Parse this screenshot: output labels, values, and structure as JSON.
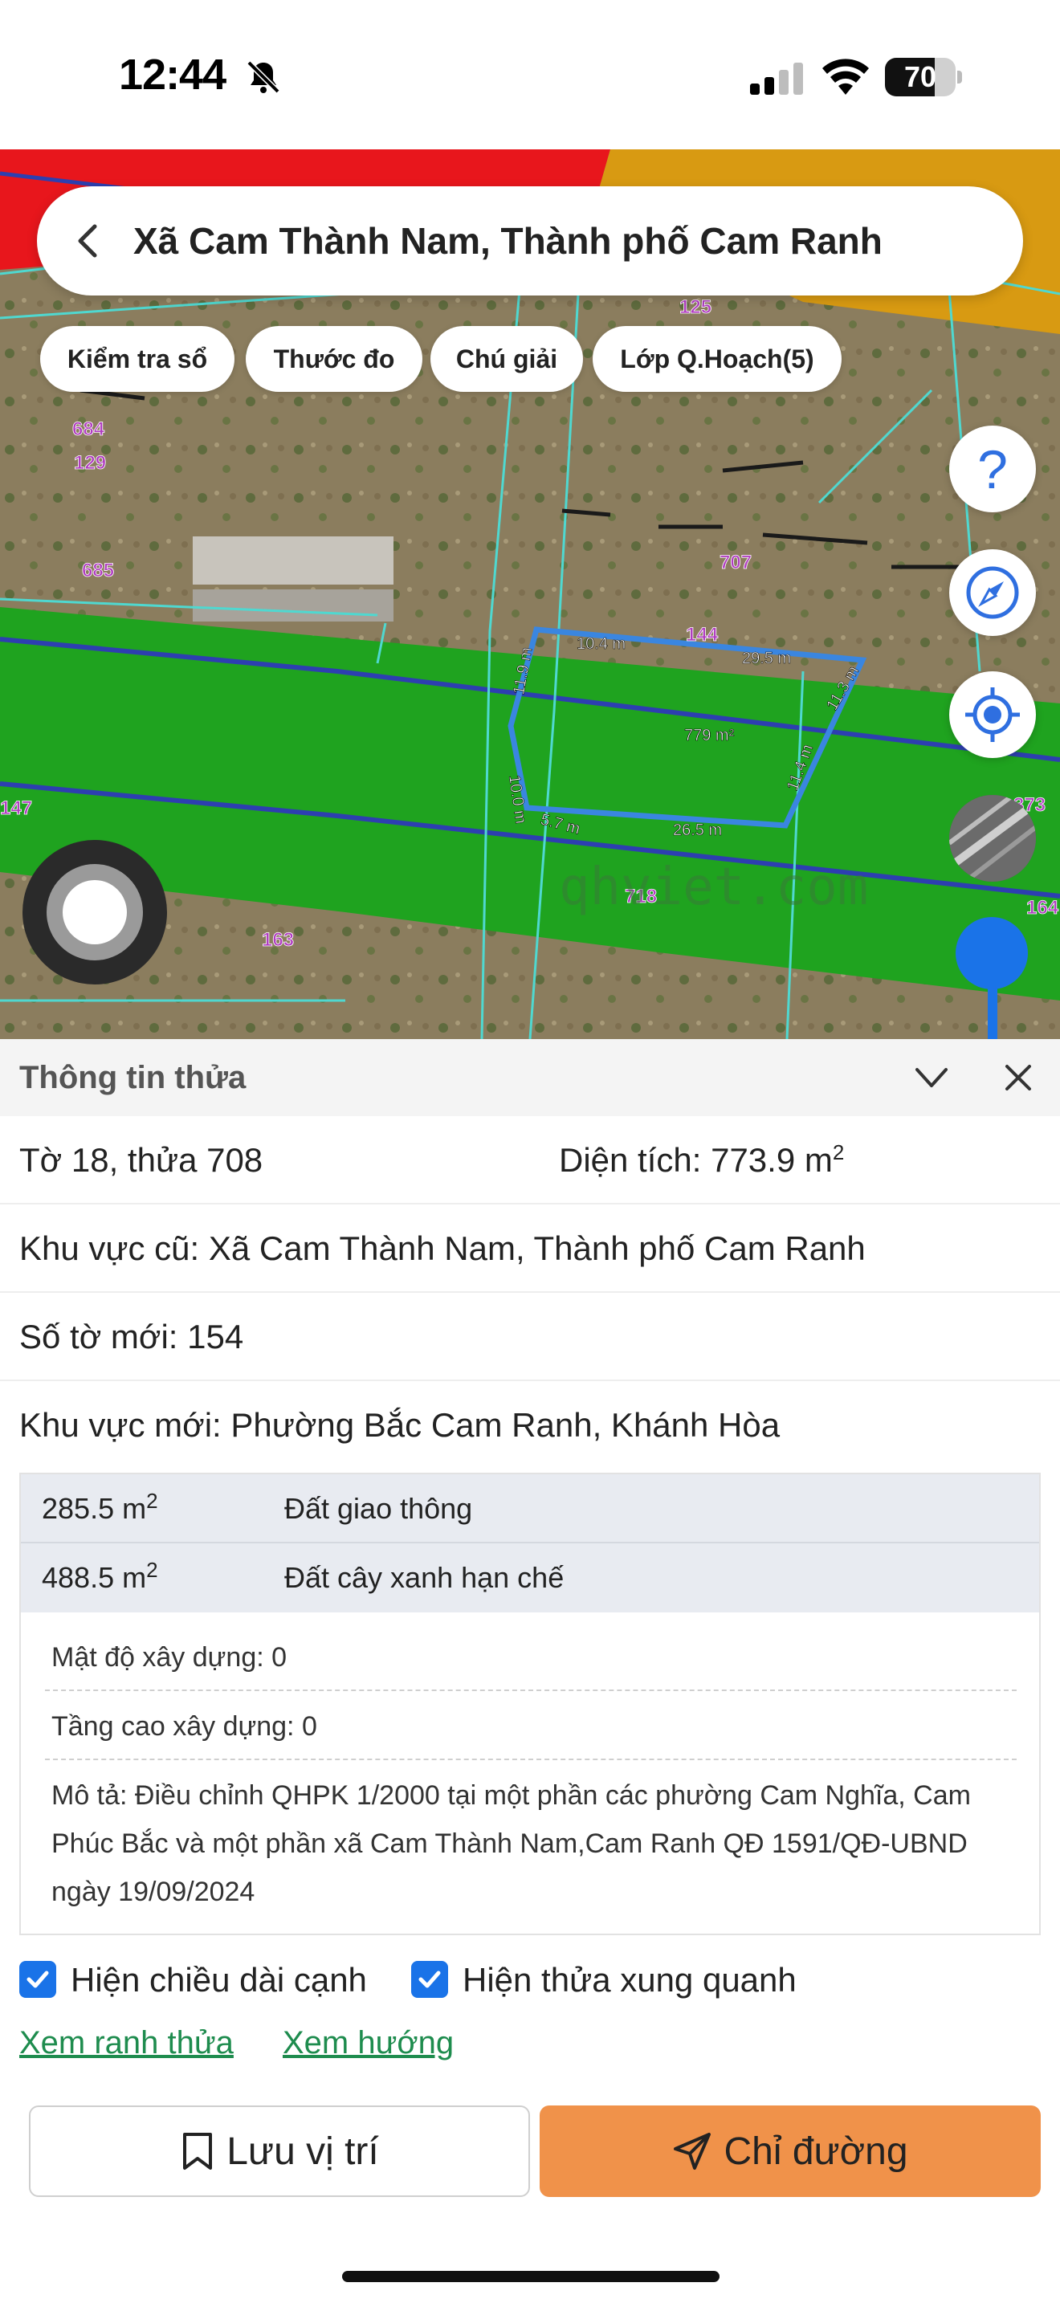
{
  "status_bar": {
    "time": "12:44",
    "battery_percent": "70",
    "battery_level": 0.7,
    "icons": [
      "bell-slash-icon",
      "signal-icon",
      "wifi-icon",
      "battery-icon"
    ]
  },
  "search": {
    "title": "Xã Cam Thành Nam, Thành phố Cam Ranh"
  },
  "chips": [
    "Kiểm tra sổ",
    "Thước đo",
    "Chú giải",
    "Lớp Q.Hoạch(5)"
  ],
  "fabs": [
    "help-icon",
    "compass-icon",
    "locate-icon"
  ],
  "map": {
    "parcel_numbers": [
      "125",
      "684",
      "129",
      "685",
      "707",
      "144",
      "147",
      "163",
      "718",
      "164",
      "373"
    ],
    "edge_lengths": [
      "10.4 m",
      "29.5 m",
      "11.9 m",
      "11.3 m",
      "779 m²",
      "11.4 m",
      "10.0 m",
      "5.7 m",
      "26.5 m"
    ],
    "watermark": "qhviet.com",
    "colors": {
      "zone_green": "#1fa31f",
      "zone_red": "#e8161c",
      "zone_orange": "#d89a12",
      "parcel_outline": "#3a86e0",
      "boundary": "#4fd8d0"
    }
  },
  "panel": {
    "title": "Thông tin thửa",
    "sheet_parcel": "Tờ 18, thửa 708",
    "area_label": "Diện tích: 773.9 m",
    "area_sup": "2",
    "old_area": "Khu vực cũ: Xã Cam Thành Nam, Thành phố Cam Ranh",
    "new_sheet": "Số tờ mới: 154",
    "new_area": "Khu vực mới: Phường Bắc Cam Ranh, Khánh Hòa",
    "zones": [
      {
        "area": "285.5 m",
        "sup": "2",
        "type": "Đất giao thông"
      },
      {
        "area": "488.5 m",
        "sup": "2",
        "type": "Đất cây xanh hạn chế"
      }
    ],
    "density": "Mật độ xây dựng: 0",
    "height": "Tầng cao xây dựng: 0",
    "description_lines": [
      "Mô tả: Điều chỉnh QHPK 1/2000 tại một phần các phường Cam Nghĩa, Cam",
      "Phúc Bắc và một phần xã Cam Thành Nam,Cam Ranh QĐ 1591/QĐ-UBND",
      "ngày 19/09/2024"
    ]
  },
  "options": {
    "show_edge_length": "Hiện chiều dài cạnh",
    "show_neighbors": "Hiện thửa xung quanh",
    "show_edge_length_checked": true,
    "show_neighbors_checked": true
  },
  "links": {
    "view_boundary": "Xem ranh thửa",
    "view_direction": "Xem hướng"
  },
  "actions": {
    "save": "Lưu vị trí",
    "route": "Chỉ đường"
  }
}
